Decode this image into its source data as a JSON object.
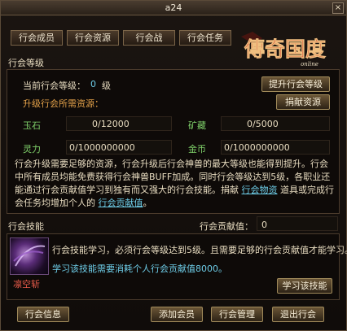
{
  "window": {
    "title": "a24",
    "close_glyph": "×"
  },
  "tabs": [
    "行会成员",
    "行会资源",
    "行会战",
    "行会任务"
  ],
  "logo": {
    "text": "傳奇国度",
    "sub": "online"
  },
  "guild_level": {
    "section_title": "行会等级",
    "current_label": "当前行会等级：",
    "current_value": "0",
    "current_unit": "级",
    "upgrade_button": "提升行会等级",
    "resources_title": "升级行会所需资源：",
    "donate_button": "捐献资源",
    "resources": [
      {
        "name": "玉石",
        "value": "0/12000"
      },
      {
        "name": "矿藏",
        "value": "0/5000"
      },
      {
        "name": "灵力",
        "value": "0/1000000000"
      },
      {
        "name": "金币",
        "value": "0/1000000000"
      }
    ],
    "description_parts": [
      "行会升级需要足够的资源，行会升级后行会神兽的最大等级也能得到提升。行会中所有成员均能免费获得行会神兽BUFF加成。同时行会等级达到5级，各职业还能通过行会贡献值学习到独有而又强大的行会技能。捐献",
      "行会物资",
      "道具或完成行会任务均增加个人的",
      "行会贡献值",
      "。"
    ]
  },
  "guild_skill": {
    "section_title": "行会技能",
    "contribution_label": "行会贡献值：",
    "contribution_value": "0",
    "skill_name": "凛空斩",
    "info_line1": "行会技能学习，必须行会等级达到5级。且需要足够的行会贡献值才能学习。",
    "info_line2": "学习该技能需要消耗个人行会贡献值8000。",
    "learn_button": "学习该技能"
  },
  "bottom_buttons": [
    "行会信息",
    "添加会员",
    "行会管理",
    "退出行会"
  ]
}
